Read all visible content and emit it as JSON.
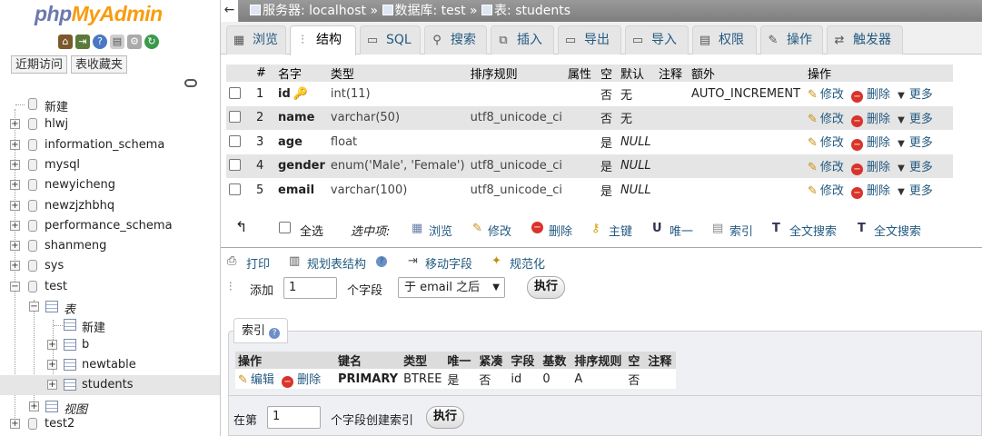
{
  "logo": {
    "php": "php",
    "admin": "MyAdmin"
  },
  "nav": {
    "tabs": [
      "近期访问",
      "表收藏夹"
    ],
    "new_label": "新建",
    "databases": [
      "hlwj",
      "information_schema",
      "mysql",
      "newyicheng",
      "newzjzhbhq",
      "performance_schema",
      "shanmeng",
      "sys",
      "test",
      "test2"
    ],
    "test_children": {
      "tables_group": "表",
      "new_table": "新建",
      "tables": [
        "b",
        "newtable",
        "students"
      ],
      "views_group": "视图"
    }
  },
  "breadcrumb": {
    "server": "服务器: localhost",
    "sep": "»",
    "database": "数据库: test",
    "table": "表: students"
  },
  "tabs": [
    "浏览",
    "结构",
    "SQL",
    "搜索",
    "插入",
    "导出",
    "导入",
    "权限",
    "操作",
    "触发器"
  ],
  "structure": {
    "headers": [
      "#",
      "名字",
      "类型",
      "排序规则",
      "属性",
      "空",
      "默认",
      "注释",
      "额外",
      "操作"
    ],
    "rows": [
      {
        "num": "1",
        "name": "id",
        "type": "int(11)",
        "collation": "",
        "attr": "",
        "null": "否",
        "default": "无",
        "comment": "",
        "extra": "AUTO_INCREMENT"
      },
      {
        "num": "2",
        "name": "name",
        "type": "varchar(50)",
        "collation": "utf8_unicode_ci",
        "attr": "",
        "null": "否",
        "default": "无",
        "comment": "",
        "extra": ""
      },
      {
        "num": "3",
        "name": "age",
        "type": "float",
        "collation": "",
        "attr": "",
        "null": "是",
        "default": "NULL",
        "comment": "",
        "extra": ""
      },
      {
        "num": "4",
        "name": "gender",
        "type": "enum('Male', 'Female')",
        "collation": "utf8_unicode_ci",
        "attr": "",
        "null": "是",
        "default": "NULL",
        "comment": "",
        "extra": ""
      },
      {
        "num": "5",
        "name": "email",
        "type": "varchar(100)",
        "collation": "utf8_unicode_ci",
        "attr": "",
        "null": "是",
        "default": "NULL",
        "comment": "",
        "extra": ""
      }
    ],
    "row_actions": {
      "edit": "修改",
      "delete": "删除",
      "more": "更多"
    }
  },
  "bulk": {
    "check_all": "全选",
    "with_selected": "选中项:",
    "actions": [
      "浏览",
      "修改",
      "删除",
      "主键",
      "唯一",
      "索引",
      "全文搜索",
      "全文搜索"
    ]
  },
  "tools": {
    "print": "打印",
    "propose": "规划表结构",
    "move": "移动字段",
    "normalize": "规范化",
    "add_label": "添加",
    "add_count": "1",
    "fields_label": "个字段",
    "position": "于 email 之后",
    "go": "执行"
  },
  "indexes": {
    "legend": "索引",
    "headers": [
      "操作",
      "键名",
      "类型",
      "唯一",
      "紧凑",
      "字段",
      "基数",
      "排序规则",
      "空",
      "注释"
    ],
    "row": {
      "edit": "编辑",
      "delete": "删除",
      "key": "PRIMARY",
      "type": "BTREE",
      "unique": "是",
      "packed": "否",
      "column": "id",
      "cardinality": "0",
      "collation": "A",
      "null": "否",
      "comment": ""
    },
    "create_prefix": "在第",
    "create_count": "1",
    "create_suffix": "个字段创建索引",
    "go": "执行"
  }
}
